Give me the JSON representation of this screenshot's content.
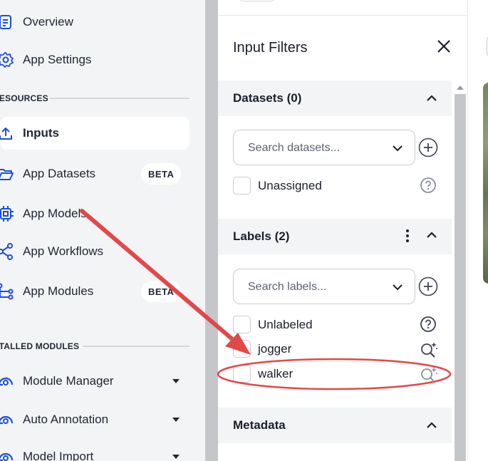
{
  "sidebar": {
    "items_top": [
      {
        "label": "Overview",
        "icon": "document-icon"
      },
      {
        "label": "App Settings",
        "icon": "gear-icon"
      }
    ],
    "resources_heading": "RESOURCES",
    "resources": [
      {
        "label": "Inputs",
        "icon": "upload-icon",
        "active": true
      },
      {
        "label": "App Datasets",
        "icon": "folder-icon",
        "badge": "BETA"
      },
      {
        "label": "App Models",
        "icon": "chip-icon"
      },
      {
        "label": "App Workflows",
        "icon": "share-icon"
      },
      {
        "label": "App Modules",
        "icon": "modules-icon",
        "badge": "BETA"
      }
    ],
    "modules_heading": "INSTALLED MODULES",
    "modules": [
      {
        "label": "Module Manager",
        "icon": "module-icon"
      },
      {
        "label": "Auto Annotation",
        "icon": "module-icon"
      },
      {
        "label": "Model Import",
        "icon": "module-icon"
      }
    ]
  },
  "panel": {
    "title": "Input Filters",
    "datasets": {
      "heading": "Datasets (0)",
      "search_placeholder": "Search datasets...",
      "options": [
        {
          "label": "Unassigned",
          "icon": "help-icon"
        }
      ]
    },
    "labels": {
      "heading": "Labels (2)",
      "search_placeholder": "Search labels...",
      "options": [
        {
          "label": "Unlabeled",
          "icon": "help-icon"
        },
        {
          "label": "jogger",
          "icon": "magic-search-icon"
        },
        {
          "label": "walker",
          "icon": "magic-search-icon"
        }
      ]
    },
    "metadata": {
      "heading": "Metadata"
    }
  },
  "colors": {
    "sidebar_bg": "#f3f4f6",
    "annotation": "#e34848"
  }
}
